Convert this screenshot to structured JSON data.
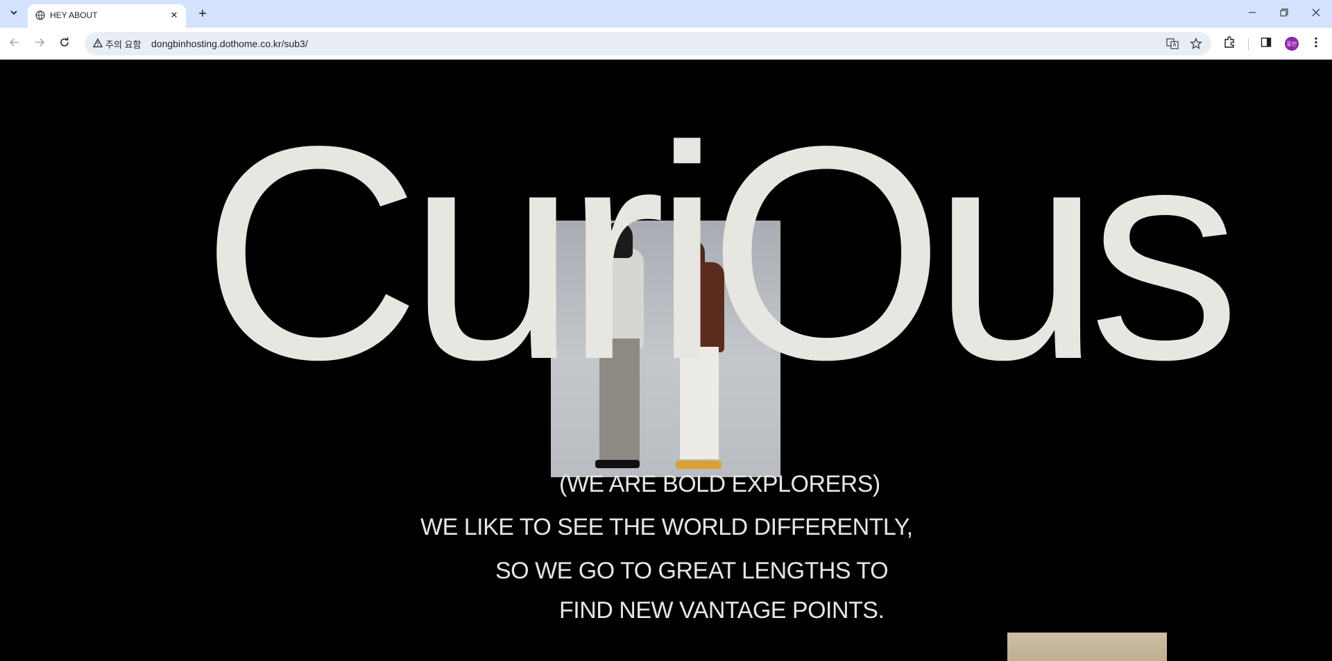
{
  "browser": {
    "tab": {
      "title": "HEY ABOUT"
    },
    "omnibox": {
      "security_label": "주의 요함",
      "url": "dongbinhosting.dothome.co.kr/sub3/"
    },
    "profile": {
      "initials": "동빈"
    }
  },
  "page": {
    "hero_word": "CuriOus",
    "lines": [
      "(WE ARE BOLD EXPLORERS)",
      "WE LIKE TO SEE THE WORLD DIFFERENTLY,",
      "SO WE GO TO GREAT LENGTHS TO",
      "FIND NEW VANTAGE POINTS."
    ]
  }
}
